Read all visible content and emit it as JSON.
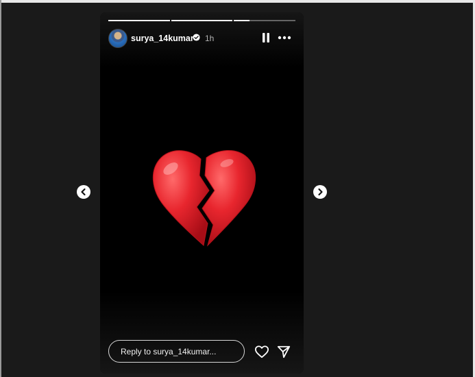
{
  "story": {
    "username": "surya_14kumar",
    "time_ago": "1h",
    "progress": [
      1.0,
      1.0,
      0.25
    ],
    "reply_placeholder": "Reply to surya_14kumar...",
    "media_content": "broken-heart-emoji"
  },
  "colors": {
    "page_bg": "#1a1a1a",
    "story_bg": "#000000",
    "heart_red": "#e0202a",
    "text": "#ffffff",
    "muted": "#b5b5b5"
  },
  "icons": {
    "verified": "verified-badge-icon",
    "pause": "pause-icon",
    "more": "more-options-icon",
    "like": "heart-outline-icon",
    "share": "paper-plane-icon",
    "prev": "chevron-left-icon",
    "next": "chevron-right-icon"
  }
}
